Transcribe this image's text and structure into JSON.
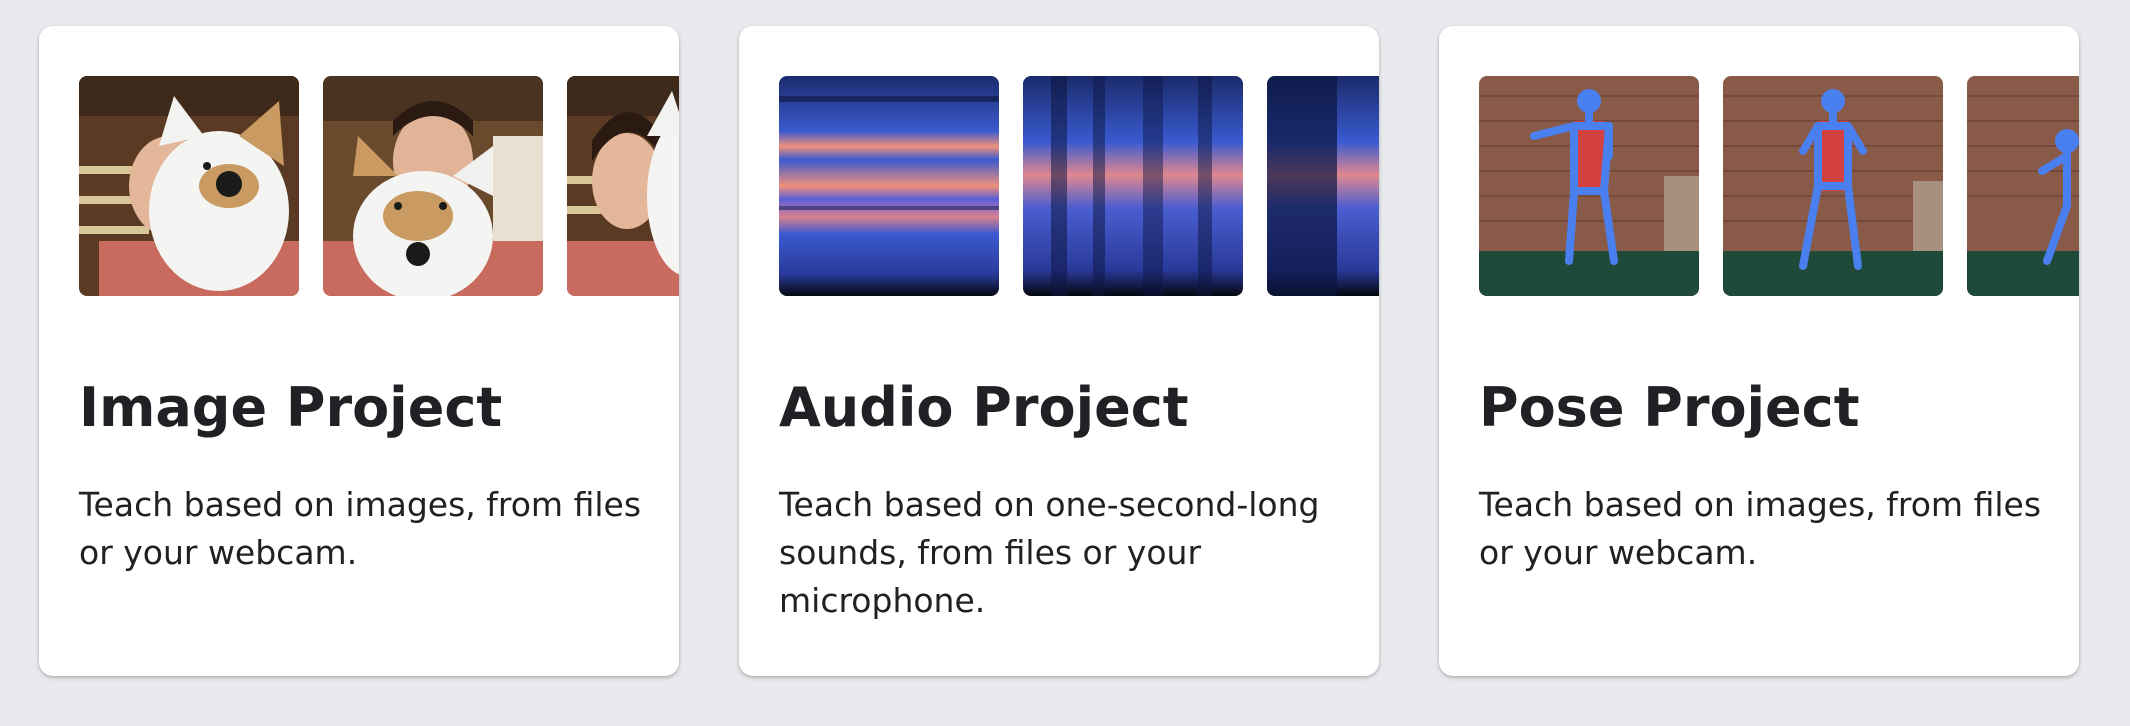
{
  "cards": [
    {
      "title": "Image Project",
      "description": "Teach based on images, from files or your webcam.",
      "thumbnails": [
        "webcam-photo",
        "webcam-photo",
        "webcam-photo"
      ]
    },
    {
      "title": "Audio Project",
      "description": "Teach based on one-second-long sounds, from files or your microphone.",
      "thumbnails": [
        "spectrogram",
        "spectrogram",
        "spectrogram"
      ]
    },
    {
      "title": "Pose Project",
      "description": "Teach based on images, from files or your webcam.",
      "thumbnails": [
        "pose-photo",
        "pose-photo",
        "pose-photo"
      ]
    }
  ],
  "colors": {
    "page_background": "#e8eaed",
    "card_background": "#ffffff",
    "text": "#202124",
    "pose_skeleton": "#4a7ff0",
    "spectrogram_base": "#1b2b6b",
    "spectrogram_highlight": "#f0907a"
  }
}
